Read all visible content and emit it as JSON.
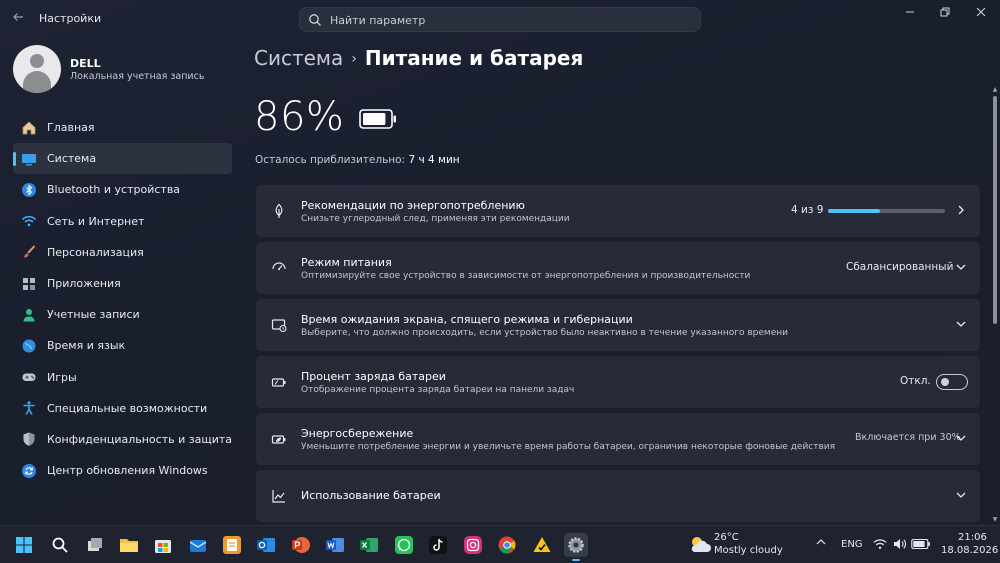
{
  "window": {
    "title": "Настройки",
    "controls": {
      "minimize_icon": "minimize-icon",
      "maximize_icon": "restore-icon",
      "close_icon": "close-icon"
    }
  },
  "search": {
    "placeholder": "Найти параметр",
    "value": ""
  },
  "profile": {
    "name": "DELL",
    "account_type": "Локальная учетная запись"
  },
  "sidebar": {
    "items": [
      {
        "label": "Главная",
        "icon": "home-icon",
        "active": false
      },
      {
        "label": "Система",
        "icon": "system-icon",
        "active": true
      },
      {
        "label": "Bluetooth и устройства",
        "icon": "bluetooth-icon",
        "active": false
      },
      {
        "label": "Сеть и Интернет",
        "icon": "wifi-icon",
        "active": false
      },
      {
        "label": "Персонализация",
        "icon": "brush-icon",
        "active": false
      },
      {
        "label": "Приложения",
        "icon": "apps-icon",
        "active": false
      },
      {
        "label": "Учетные записи",
        "icon": "accounts-icon",
        "active": false
      },
      {
        "label": "Время и язык",
        "icon": "globe-icon",
        "active": false
      },
      {
        "label": "Игры",
        "icon": "gamepad-icon",
        "active": false
      },
      {
        "label": "Специальные возможности",
        "icon": "accessibility-icon",
        "active": false
      },
      {
        "label": "Конфиденциальность и защита",
        "icon": "shield-icon",
        "active": false
      },
      {
        "label": "Центр обновления Windows",
        "icon": "update-icon",
        "active": false
      }
    ]
  },
  "breadcrumb": {
    "parent": "Система",
    "separator": "›",
    "current": "Питание и батарея"
  },
  "battery": {
    "percent_text": "86%",
    "level": 0.86,
    "remaining_label": "Осталось приблизительно:",
    "remaining_value": "7 ч 4 мин"
  },
  "cards": {
    "recommendations": {
      "title": "Рекомендации по энергопотреблению",
      "subtitle": "Снизьте углеродный след, применяя эти рекомендации",
      "progress_text": "4 из 9",
      "progress_fraction": 0.444
    },
    "power_mode": {
      "title": "Режим питания",
      "subtitle": "Оптимизируйте свое устройство в зависимости от энергопотребления и производительности",
      "value": "Сбалансированный"
    },
    "screen_timeout": {
      "title": "Время ожидания экрана, спящего режима и гибернации",
      "subtitle": "Выберите, что должно происходить, если устройство было неактивно в течение указанного времени"
    },
    "battery_percent": {
      "title": "Процент заряда батареи",
      "subtitle": "Отображение процента заряда батареи на панели задач",
      "toggle_label": "Откл.",
      "toggle_on": false
    },
    "energy_saver": {
      "title": "Энергосбережение",
      "subtitle": "Уменьшите потребление энергии и увеличьте время работы батареи, ограничив некоторые фоновые действия",
      "value": "Включается при 30%"
    },
    "battery_usage": {
      "title": "Использование батареи"
    }
  },
  "taskbar": {
    "apps": [
      "start-icon",
      "search-icon",
      "task-view-icon",
      "file-explorer-icon",
      "store-icon",
      "mail-icon",
      "fluent-app-icon",
      "outlook-icon",
      "powerpoint-icon",
      "word-icon",
      "excel-icon",
      "whatsapp-icon",
      "tiktok-icon",
      "instagram-icon",
      "chrome-icon",
      "norton-icon",
      "settings-icon"
    ],
    "weather": {
      "temp": "26°C",
      "desc": "Mostly cloudy",
      "icon": "partly-cloudy-icon"
    },
    "tray": {
      "lang": "ENG",
      "icons": [
        "chevron-up-icon",
        "wifi-icon",
        "volume-icon",
        "battery-icon"
      ]
    },
    "clock": {
      "time": "21:06",
      "date": "18.08.2026"
    }
  },
  "colors": {
    "accent": "#4cc2ff",
    "background": "#1b2030",
    "card": "#272b38"
  }
}
